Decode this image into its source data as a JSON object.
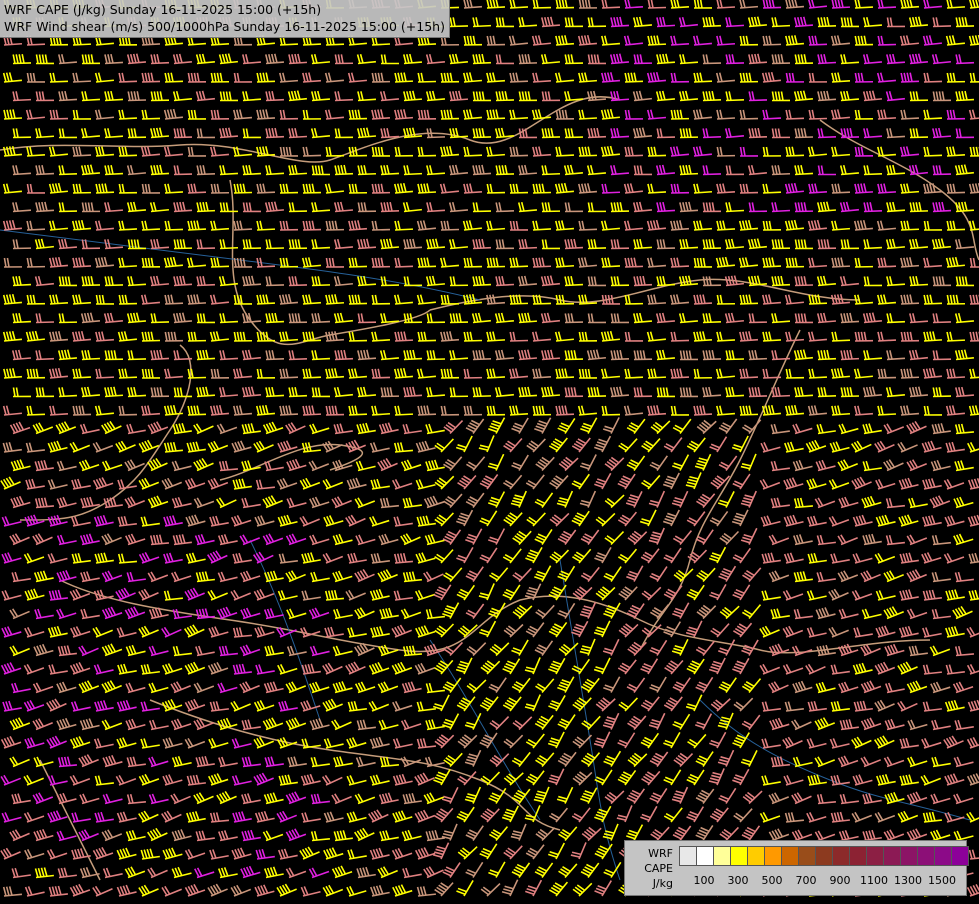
{
  "titles": {
    "line1": "WRF CAPE (J/kg) Sunday 16-11-2025 15:00 (+15h)",
    "line2": "WRF Wind shear (m/s) 500/1000hPa Sunday 16-11-2025 15:00 (+15h)"
  },
  "legend": {
    "line1": "WRF",
    "line2": "CAPE",
    "line3": "J/kg",
    "colors": [
      "#e8e8e8",
      "#ffffff",
      "#ffff99",
      "#ffff00",
      "#ffcc00",
      "#ff9900",
      "#cc6600",
      "#994d1a",
      "#8c3a1f",
      "#8c2a2a",
      "#8c2233",
      "#8c1f44",
      "#8c1a55",
      "#8c1466",
      "#8c0f77",
      "#8c0a88",
      "#8c0099"
    ],
    "tick_labels": [
      "100",
      "300",
      "500",
      "700",
      "900",
      "1100",
      "1300",
      "1500"
    ]
  },
  "shear_colors": {
    "weak": "#e08080",
    "moderate": "#ffff00",
    "strong": "#c8957a",
    "extreme": "#e020e0"
  }
}
